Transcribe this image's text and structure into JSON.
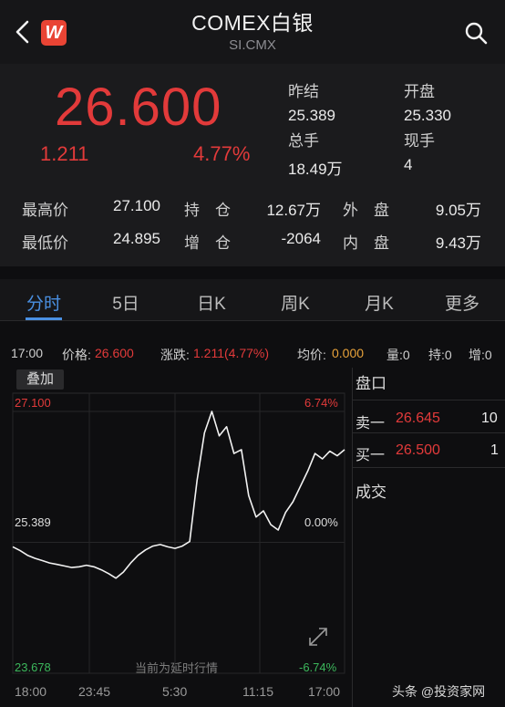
{
  "header": {
    "title": "COMEX白银",
    "subtitle": "SI.CMX",
    "logo_text": "W"
  },
  "quote": {
    "price": "26.600",
    "change": "1.211",
    "change_pct": "4.77%",
    "prev_close_label": "昨结",
    "prev_close": "25.389",
    "open_label": "开盘",
    "open": "25.330",
    "volume_label": "总手",
    "volume": "18.49万",
    "last_lot_label": "现手",
    "last_lot": "4"
  },
  "stats": {
    "high_label": "最高价",
    "high": "27.100",
    "low_label": "最低价",
    "low": "24.895",
    "oi_label": "持　仓",
    "oi": "12.67万",
    "oi_chg_label": "增　仓",
    "oi_chg": "-2064",
    "outer_label": "外　盘",
    "outer": "9.05万",
    "inner_label": "内　盘",
    "inner": "9.43万"
  },
  "tabs": [
    "分时",
    "5日",
    "日K",
    "周K",
    "月K",
    "更多"
  ],
  "info": {
    "time": "17:00",
    "price_label": "价格:",
    "price": "26.600",
    "change_label": "涨跌:",
    "change": "1.211(4.77%)",
    "avg_label": "均价:",
    "avg": "0.000",
    "vol_label": "量:0",
    "oi_label": "持:0",
    "inc_label": "增:0"
  },
  "chart": {
    "overlay_label": "叠加",
    "y_top": "27.100",
    "y_top_pct": "6.74%",
    "y_mid": "25.389",
    "y_mid_pct": "0.00%",
    "y_bot": "23.678",
    "y_bot_pct": "-6.74%",
    "x_labels": [
      "18:00",
      "23:45",
      "5:30",
      "11:15",
      "17:00"
    ],
    "delay_note": "当前为延时行情"
  },
  "panel": {
    "book_label": "盘口",
    "ask_label": "卖一",
    "ask_price": "26.645",
    "ask_qty": "10",
    "bid_label": "买一",
    "bid_price": "26.500",
    "bid_qty": "1",
    "trades_label": "成交"
  },
  "watermark": "头条 @投资家网",
  "colors": {
    "up": "#e23a3a",
    "accent": "#4a90e2",
    "avg": "#e8a23a"
  },
  "chart_data": {
    "type": "line",
    "title": "",
    "xlabel": "",
    "ylabel": "",
    "ylim": [
      23.678,
      27.1
    ],
    "x": [
      "18:00",
      "23:45",
      "5:30",
      "11:15",
      "17:00"
    ],
    "series": [
      {
        "values": [
          25.33,
          25.28,
          25.22,
          25.18,
          25.15,
          25.12,
          25.1,
          25.08,
          25.06,
          25.07,
          25.09,
          25.07,
          25.03,
          24.98,
          24.92,
          25.0,
          25.12,
          25.22,
          25.29,
          25.34,
          25.36,
          25.33,
          25.31,
          25.34,
          25.4,
          26.2,
          26.82,
          27.1,
          26.78,
          26.9,
          26.55,
          26.6,
          26.0,
          25.72,
          25.8,
          25.62,
          25.55,
          25.78,
          25.92,
          26.12,
          26.32,
          26.55,
          26.48,
          26.58,
          26.52,
          26.6
        ]
      }
    ]
  }
}
